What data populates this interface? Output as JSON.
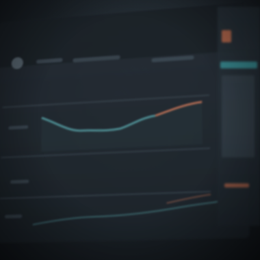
{
  "scene": {
    "subject": "blurred-monitor-with-line-chart-dashboard",
    "colors": {
      "background": "#14181d",
      "screen": "#242c34",
      "teal_line": "#5fb3b8",
      "orange_line": "#d97a5a",
      "sidebar_teal": "#3a9aa0",
      "sidebar_orange": "#d0704e"
    }
  }
}
